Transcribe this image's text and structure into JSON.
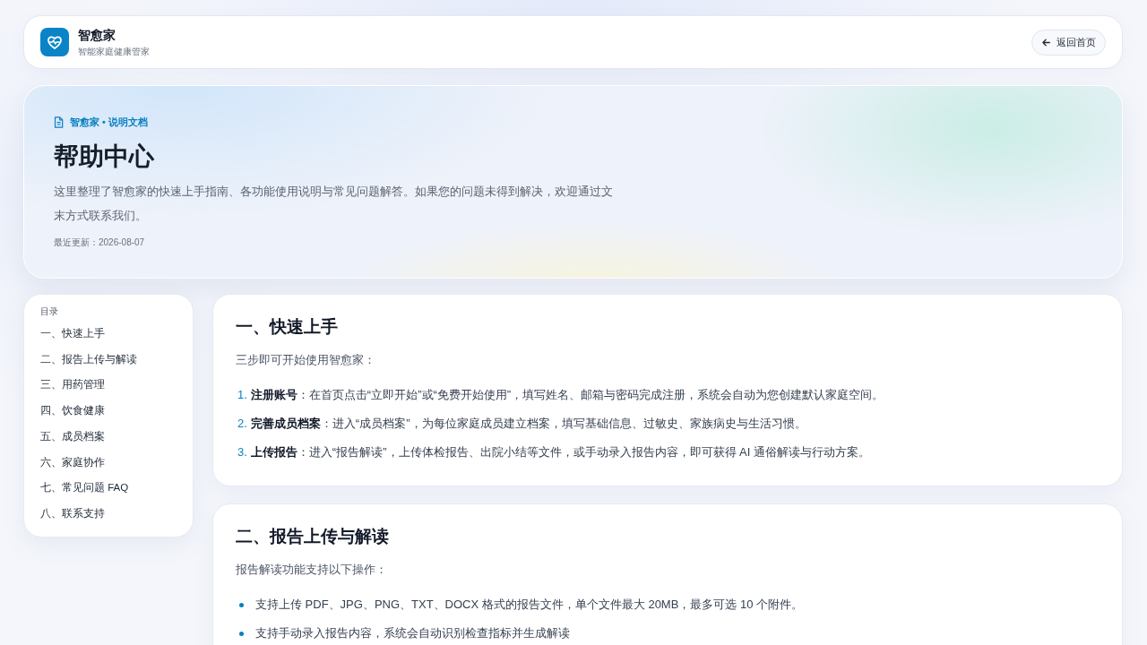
{
  "header": {
    "brand": {
      "name": "智愈家",
      "tagline": "智能家庭健康管家"
    },
    "back_button": {
      "label": "返回首页"
    }
  },
  "hero": {
    "eyebrow": "智愈家 • 说明文档",
    "title": "帮助中心",
    "description": "这里整理了智愈家的快速上手指南、各功能使用说明与常见问题解答。如果您的问题未得到解决，欢迎通过文末方式联系我们。",
    "updated": "最近更新：2026-08-07"
  },
  "toc": {
    "title": "目录",
    "items": [
      {
        "label": "一、快速上手"
      },
      {
        "label": "二、报告上传与解读"
      },
      {
        "label": "三、用药管理"
      },
      {
        "label": "四、饮食健康"
      },
      {
        "label": "五、成员档案"
      },
      {
        "label": "六、家庭协作"
      },
      {
        "label": "七、常见问题 FAQ"
      },
      {
        "label": "八、联系支持"
      }
    ]
  },
  "sections": [
    {
      "title": "一、快速上手",
      "intro": "三步即可开始使用智愈家：",
      "items": [
        {
          "kind": "numbered",
          "number": "1.",
          "text": "**注册账号**：在首页点击“立即开始”或“免费开始使用”，填写姓名、邮箱与密码完成注册，系统会自动为您创建默认家庭空间。"
        },
        {
          "kind": "numbered",
          "number": "2.",
          "text": "**完善成员档案**：进入“成员档案”，为每位家庭成员建立档案，填写基础信息、过敏史、家族病史与生活习惯。"
        },
        {
          "kind": "numbered",
          "number": "3.",
          "text": "**上传报告**：进入“报告解读”，上传体检报告、出院小结等文件，或手动录入报告内容，即可获得 AI 通俗解读与行动方案。"
        }
      ]
    },
    {
      "title": "二、报告上传与解读",
      "intro": "报告解读功能支持以下操作：",
      "items": [
        {
          "kind": "bullet",
          "text": "支持上传 PDF、JPG、PNG、TXT、DOCX 格式的报告文件，单个文件最大 20MB，最多可选 10 个附件。"
        },
        {
          "kind": "bullet",
          "text": "支持手动录入报告内容，系统会自动识别检查指标并生成解读"
        }
      ]
    }
  ]
}
